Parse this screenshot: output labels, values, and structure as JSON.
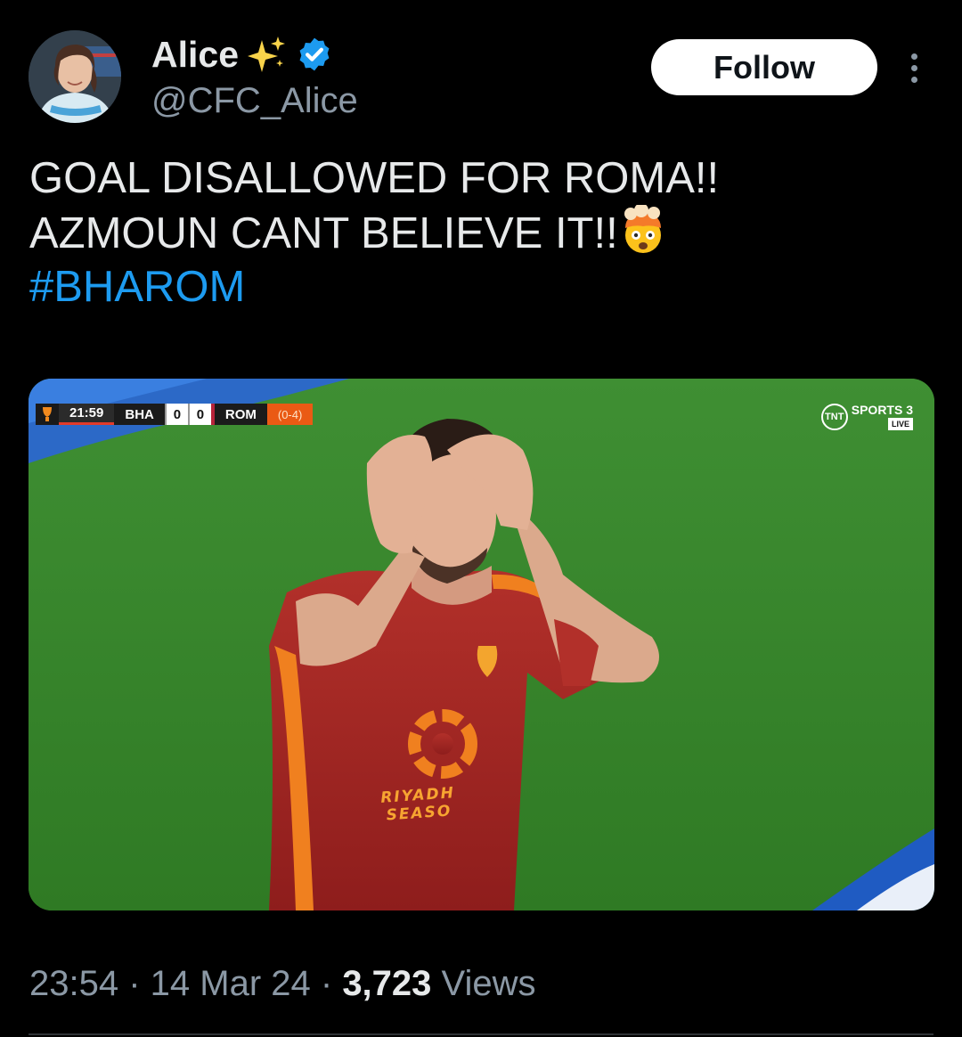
{
  "author": {
    "display_name": "Alice",
    "handle": "@CFC_Alice",
    "verified": true,
    "name_emoji": "sparkles-icon"
  },
  "actions": {
    "follow_label": "Follow",
    "more_icon": "more-vertical-icon"
  },
  "tweet": {
    "line1": "GOAL DISALLOWED FOR ROMA!!",
    "line2": "AZMOUN CANT BELIEVE IT!!",
    "line2_emoji": "exploding-head-icon",
    "hashtag": "#BHAROM"
  },
  "media": {
    "scorebug": {
      "clock": "21:59",
      "home_team": "BHA",
      "home_score": "0",
      "away_score": "0",
      "away_team": "ROM",
      "aggregate": "(0-4)"
    },
    "broadcaster": {
      "tnt": "TNT",
      "name": "SPORTS 3",
      "live": "LIVE"
    },
    "shirt_sponsor_line1": "RIYADH",
    "shirt_sponsor_line2": "SEASO"
  },
  "footer": {
    "time": "23:54",
    "sep1": " · ",
    "date": "14 Mar 24",
    "sep2": " · ",
    "views_count": "3,723",
    "views_label": " Views"
  },
  "colors": {
    "background": "#000000",
    "text": "#e7e9ea",
    "muted": "#8b98a5",
    "link": "#1d9bf0",
    "follow_bg": "#ffffff"
  }
}
